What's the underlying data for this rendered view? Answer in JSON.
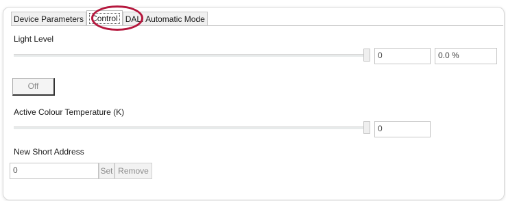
{
  "tabs": [
    {
      "label": "Device Parameters",
      "active": false
    },
    {
      "label": "Control",
      "active": true
    },
    {
      "label": "DALI Automatic Mode",
      "active": false
    }
  ],
  "light_level": {
    "label": "Light Level",
    "slider_fraction": 1.0,
    "value": "0",
    "percent": "0.0 %",
    "toggle_label": "Off"
  },
  "colour_temperature": {
    "label": "Active Colour Temperature (K)",
    "slider_fraction": 1.0,
    "value": "0"
  },
  "short_address": {
    "label": "New Short Address",
    "value": "0",
    "set_label": "Set",
    "remove_label": "Remove"
  },
  "colors": {
    "highlight": "#b5173d",
    "border": "#c4c4c4"
  }
}
